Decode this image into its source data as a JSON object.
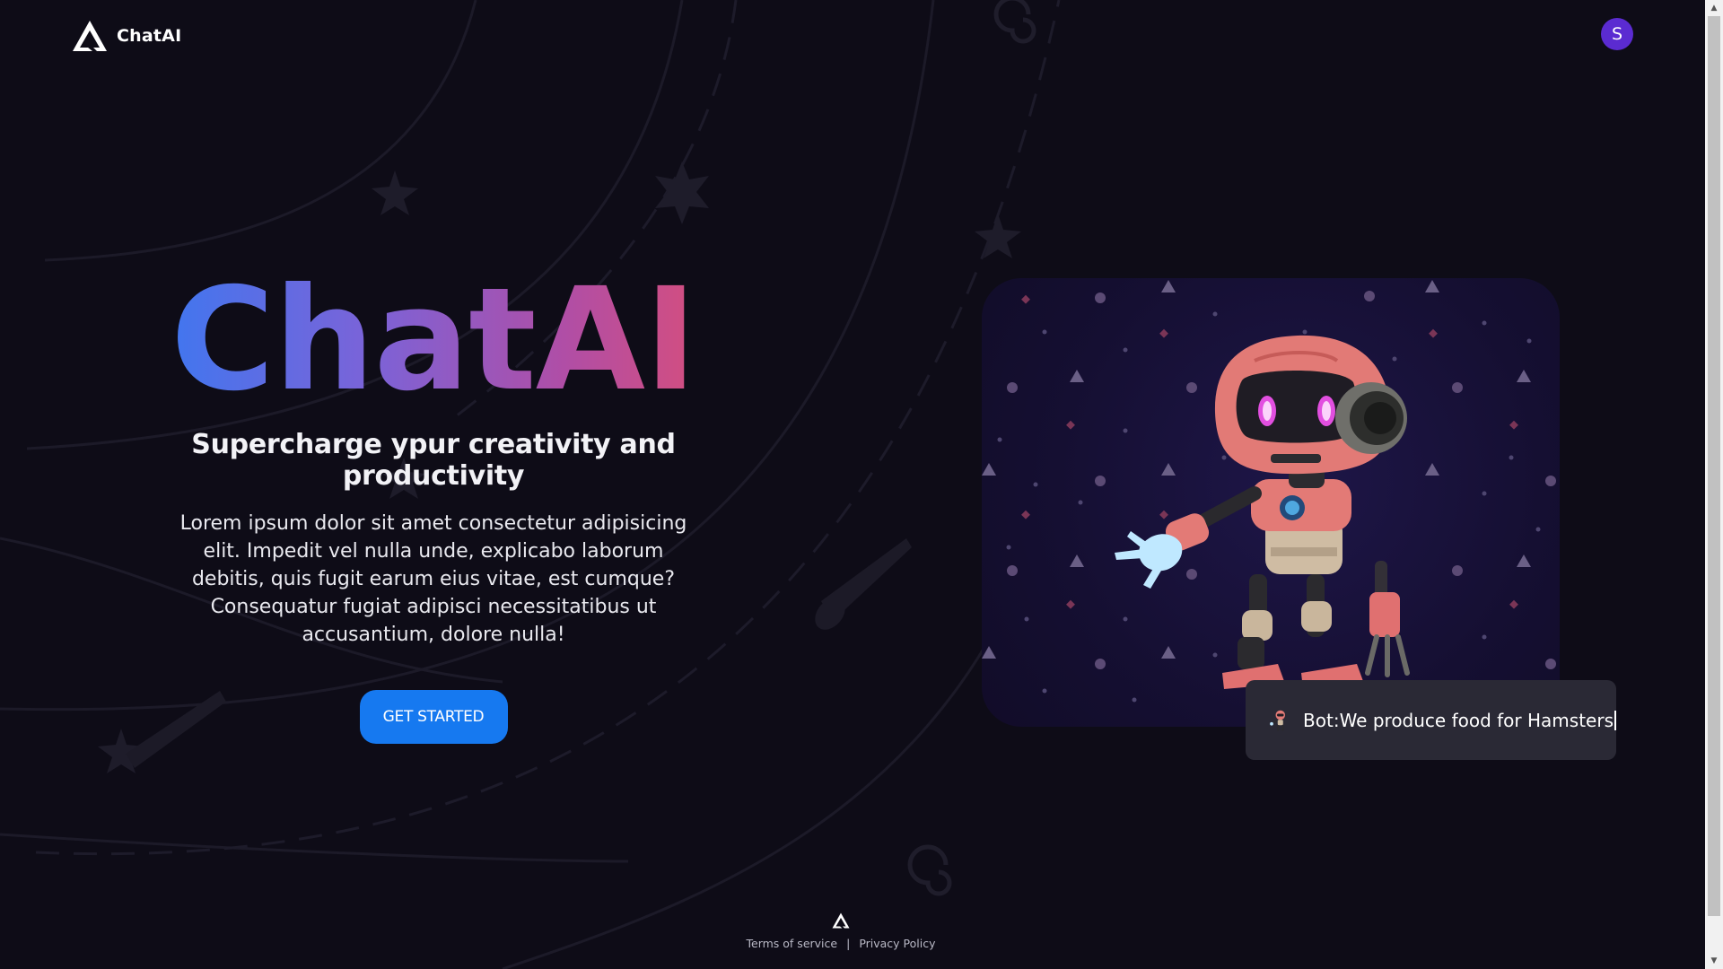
{
  "brand": {
    "name": "ChatAI"
  },
  "user": {
    "avatar_initial": "S"
  },
  "hero": {
    "title": "ChatAI",
    "subtitle": "Supercharge ypur creativity and productivity",
    "description": "Lorem ipsum dolor sit amet consectetur adipisicing elit. Impedit vel nulla unde, explicabo laborum debitis, quis fugit earum eius vitae, est cumque? Consequatur fugiat adipisci necessitatibus ut accusantium, dolore nulla!",
    "cta_label": "GET STARTED"
  },
  "chat": {
    "message": "Bot:We produce food for Hamsters"
  },
  "footer": {
    "terms_label": "Terms of service",
    "separator": "|",
    "privacy_label": "Privacy Policy"
  },
  "icons": {
    "logo": "triangle-logo-icon",
    "robot": "robot-illustration",
    "bot_avatar": "robot-icon"
  },
  "colors": {
    "background": "#0e0c17",
    "accent": "#1679f0",
    "avatar": "#5b2bd1",
    "gradient_start": "#2f7cf6",
    "gradient_end": "#e34e6e",
    "chat_bubble": "#2a2935"
  }
}
